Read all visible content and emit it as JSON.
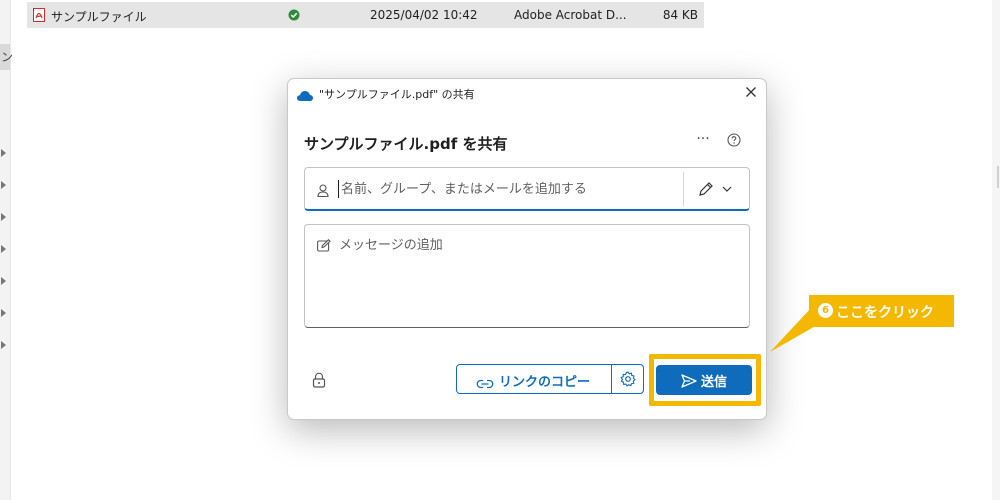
{
  "explorer": {
    "left_tab_glyph": "ン",
    "file": {
      "name": "サンプルファイル",
      "date": "2025/04/02 10:42",
      "type": "Adobe Acrobat D...",
      "size": "84 KB"
    }
  },
  "dialog": {
    "title": "\"サンプルファイル.pdf\" の共有",
    "heading": "サンプルファイル.pdf を共有",
    "more_label": "···",
    "recipient_placeholder": "名前、グループ、またはメールを追加する",
    "message_placeholder": "メッセージの追加",
    "copy_link_label": "リンクのコピー",
    "send_label": "送信"
  },
  "annotation": {
    "step_number": "6",
    "text": "ここをクリック"
  },
  "colors": {
    "accent": "#0f6cbd",
    "highlight": "#f5b800",
    "sync_ok": "#2e8b3e",
    "pdf_red": "#d32f2f"
  },
  "icons": [
    "pdf-file-icon",
    "sync-ok-icon",
    "onedrive-cloud-icon",
    "close-icon",
    "more-icon",
    "help-icon",
    "person-icon",
    "pencil-icon",
    "chevron-down-icon",
    "compose-icon",
    "lock-icon",
    "link-icon",
    "gear-icon",
    "send-icon"
  ]
}
